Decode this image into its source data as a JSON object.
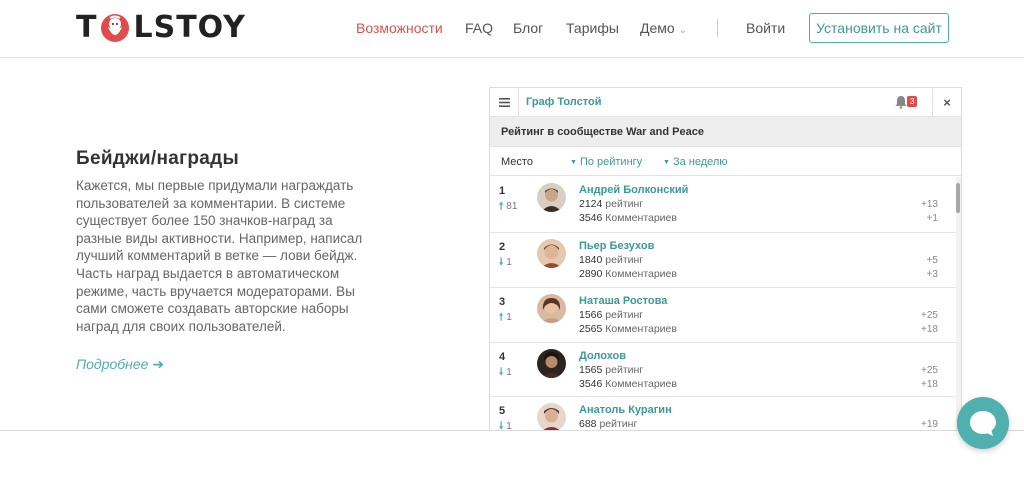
{
  "logo": {
    "left": "T",
    "right": "LSTOY",
    "mark_icon": "tolstoy-beard-icon"
  },
  "nav": {
    "items": [
      {
        "label": "Возможности",
        "active": true
      },
      {
        "label": "FAQ"
      },
      {
        "label": "Блог"
      },
      {
        "label": "Тарифы"
      },
      {
        "label": "Демо",
        "dropdown": true
      }
    ],
    "login": "Войти",
    "install": "Установить на сайт"
  },
  "feature": {
    "title": "Бейджи/награды",
    "text": "Кажется, мы первые придумали награждать пользователей за комментарии. В системе существует более 150 значков-наград за разные виды активности. Например, написал лучший комментарий в ветке — лови бейдж. Часть наград выдается в автоматическом режиме, часть вручается модераторами. Вы сами сможете создавать авторские наборы наград для своих пользователей.",
    "more": "Подробнее"
  },
  "widget": {
    "user": "Граф Толстой",
    "notifications": "3",
    "close": "×",
    "community_title": "Рейтинг в сообществе War and Peace",
    "filters": {
      "place": "Место",
      "sort": "По рейтингу",
      "period": "За неделю"
    },
    "rating_label": "рейтинг",
    "comments_label": "Комментариев",
    "rows": [
      {
        "rank": "1",
        "direction": "up",
        "move": "81",
        "name": "Андрей Болконский",
        "rating": "2124",
        "comments": "3546",
        "rating_delta": "+13",
        "comments_delta": "+1",
        "avatar_color": "#6b5a48"
      },
      {
        "rank": "2",
        "direction": "down",
        "move": "1",
        "name": "Пьер Безухов",
        "rating": "1840",
        "comments": "2890",
        "rating_delta": "+5",
        "comments_delta": "+3",
        "avatar_color": "#8a4a2e"
      },
      {
        "rank": "3",
        "direction": "up",
        "move": "1",
        "name": "Наташа Ростова",
        "rating": "1566",
        "comments": "2565",
        "rating_delta": "+25",
        "comments_delta": "+18",
        "avatar_color": "#9b6a52"
      },
      {
        "rank": "4",
        "direction": "down",
        "move": "1",
        "name": "Долохов",
        "rating": "1565",
        "comments": "3546",
        "rating_delta": "+25",
        "comments_delta": "+18",
        "avatar_color": "#3a3028"
      },
      {
        "rank": "5",
        "direction": "down",
        "move": "1",
        "name": "Анатоль Курагин",
        "rating": "688",
        "comments": "",
        "rating_delta": "+19",
        "comments_delta": "",
        "avatar_color": "#7a3a34"
      }
    ]
  },
  "colors": {
    "accent": "#4fb0ad",
    "active_nav": "#d9534f",
    "badge": "#e04b4b"
  }
}
